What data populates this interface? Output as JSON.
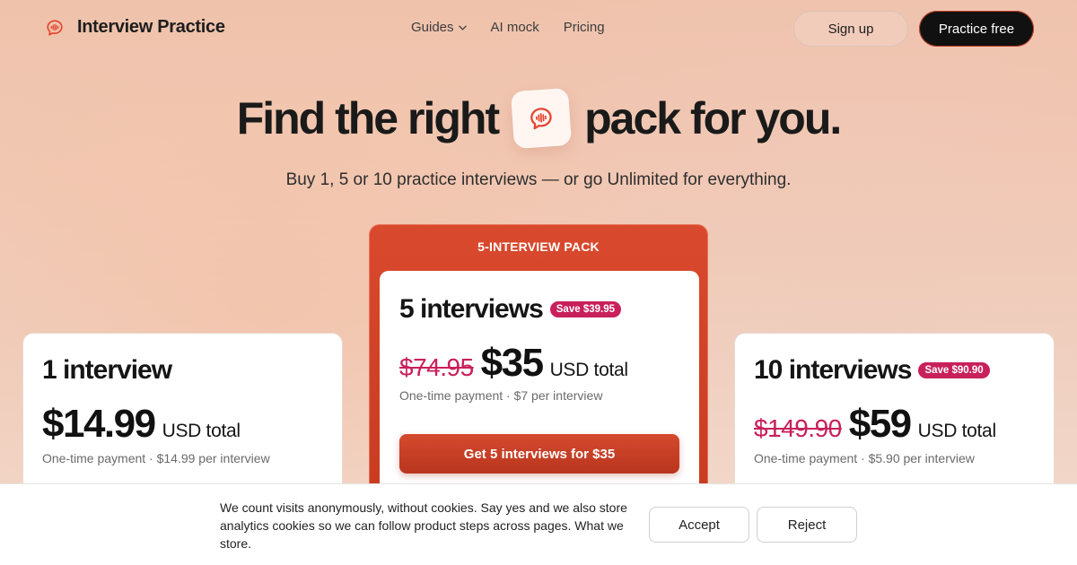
{
  "brand": {
    "name": "Interview Practice",
    "accent": "#e4452f"
  },
  "nav": {
    "links": [
      {
        "label": "Guides",
        "has_dropdown": true
      },
      {
        "label": "AI mock"
      },
      {
        "label": "Pricing"
      }
    ],
    "signup_label": "Sign up",
    "practice_label": "Practice free"
  },
  "hero": {
    "title_before": "Find the right",
    "title_after": "pack for you.",
    "subtitle": "Buy 1, 5 or 10 practice interviews — or go Unlimited for everything."
  },
  "plans": [
    {
      "title": "1 interview",
      "price": "$14.99",
      "unit": "USD total",
      "note": "One-time payment · $14.99 per interview"
    },
    {
      "featured_label": "5-INTERVIEW PACK",
      "title": "5 interviews",
      "save": "Save $39.95",
      "old_price": "$74.95",
      "price": "$35",
      "unit": "USD total",
      "note": "One-time payment · $7 per interview",
      "cta": "Get 5 interviews for $35"
    },
    {
      "title": "10 interviews",
      "save": "Save $90.90",
      "old_price": "$149.90",
      "price": "$59",
      "unit": "USD total",
      "note": "One-time payment · $5.90 per interview"
    }
  ],
  "cookie": {
    "text": "We count visits anonymously, without cookies. Say yes and we also store analytics cookies so we can follow product steps across pages. What we store.",
    "accept_label": "Accept",
    "reject_label": "Reject"
  },
  "colors": {
    "save_badge": "#c8205a",
    "featured": "#d9492d",
    "dark_button": "#111111"
  }
}
